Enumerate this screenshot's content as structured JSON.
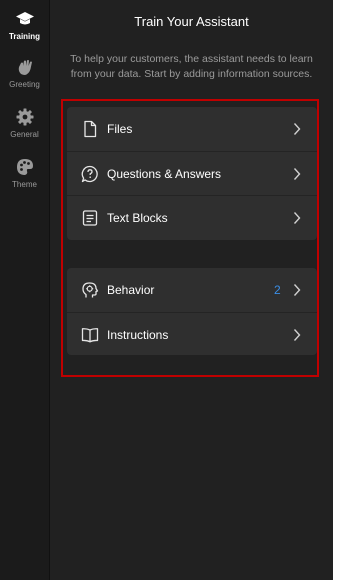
{
  "sidebar": {
    "items": [
      {
        "label": "Training",
        "icon": "graduation-cap-icon",
        "active": true
      },
      {
        "label": "Greeting",
        "icon": "waving-hand-icon",
        "active": false
      },
      {
        "label": "General",
        "icon": "gear-icon",
        "active": false
      },
      {
        "label": "Theme",
        "icon": "palette-icon",
        "active": false
      }
    ]
  },
  "main": {
    "title": "Train Your Assistant",
    "subtitle": "To help your customers, the assistant needs to learn from your data. Start by adding information sources.",
    "sources": [
      {
        "label": "Files",
        "icon": "file-icon"
      },
      {
        "label": "Questions & Answers",
        "icon": "question-chat-icon"
      },
      {
        "label": "Text Blocks",
        "icon": "text-document-icon"
      }
    ],
    "config": [
      {
        "label": "Behavior",
        "icon": "head-gear-icon",
        "badge": "2"
      },
      {
        "label": "Instructions",
        "icon": "book-icon"
      }
    ]
  },
  "colors": {
    "background": "#212121",
    "sidebar": "#1b1b1b",
    "card": "#2f2f2f",
    "accent": "#3a8ee6",
    "highlight_border": "#c00000"
  }
}
